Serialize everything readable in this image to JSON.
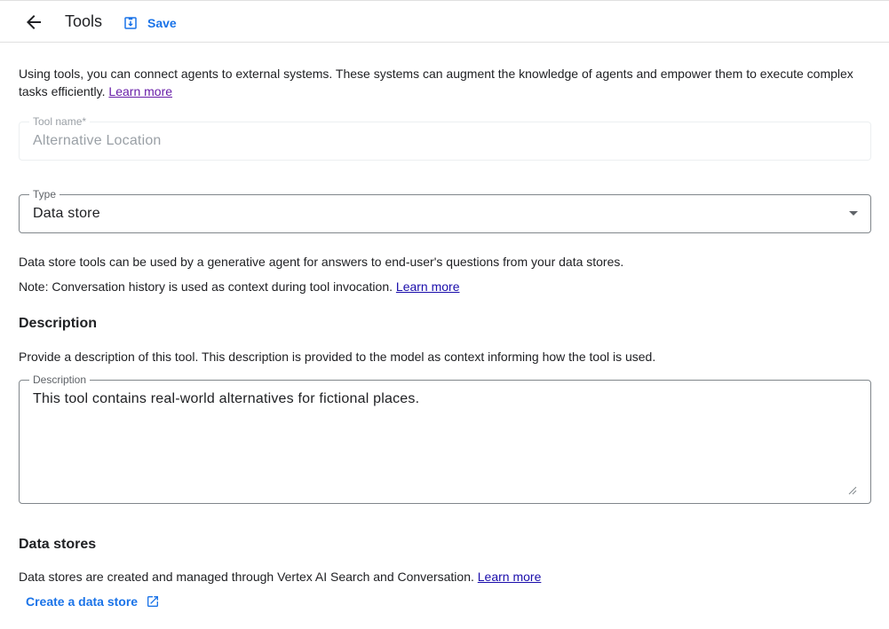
{
  "header": {
    "title": "Tools",
    "save_label": "Save"
  },
  "intro": {
    "text": "Using tools, you can connect agents to external systems. These systems can augment the knowledge of agents and empower them to execute complex tasks efficiently.",
    "link": "Learn more"
  },
  "tool_name": {
    "label": "Tool name*",
    "value": "Alternative Location"
  },
  "type": {
    "label": "Type",
    "selected": "Data store"
  },
  "type_info": {
    "line1": "Data store tools can be used by a generative agent for answers to end-user's questions from your data stores.",
    "line2": "Note: Conversation history is used as context during tool invocation.",
    "line2_link": "Learn more"
  },
  "description": {
    "heading": "Description",
    "help": "Provide a description of this tool. This description is provided to the model as context informing how the tool is used.",
    "label": "Description",
    "value": "This tool contains real-world alternatives for fictional places."
  },
  "data_stores": {
    "heading": "Data stores",
    "text": "Data stores are created and managed through Vertex AI Search and Conversation.",
    "link": "Learn more",
    "create_label": "Create a data store"
  },
  "colors": {
    "accent": "#1a73e8",
    "link": "#1a0dab",
    "visited_link": "#681da8",
    "text": "#202124",
    "muted": "#5f6368"
  },
  "icons": {
    "back": "arrow-back-icon",
    "save": "save-icon",
    "dropdown": "dropdown-arrow-icon",
    "external": "open-in-new-icon"
  }
}
